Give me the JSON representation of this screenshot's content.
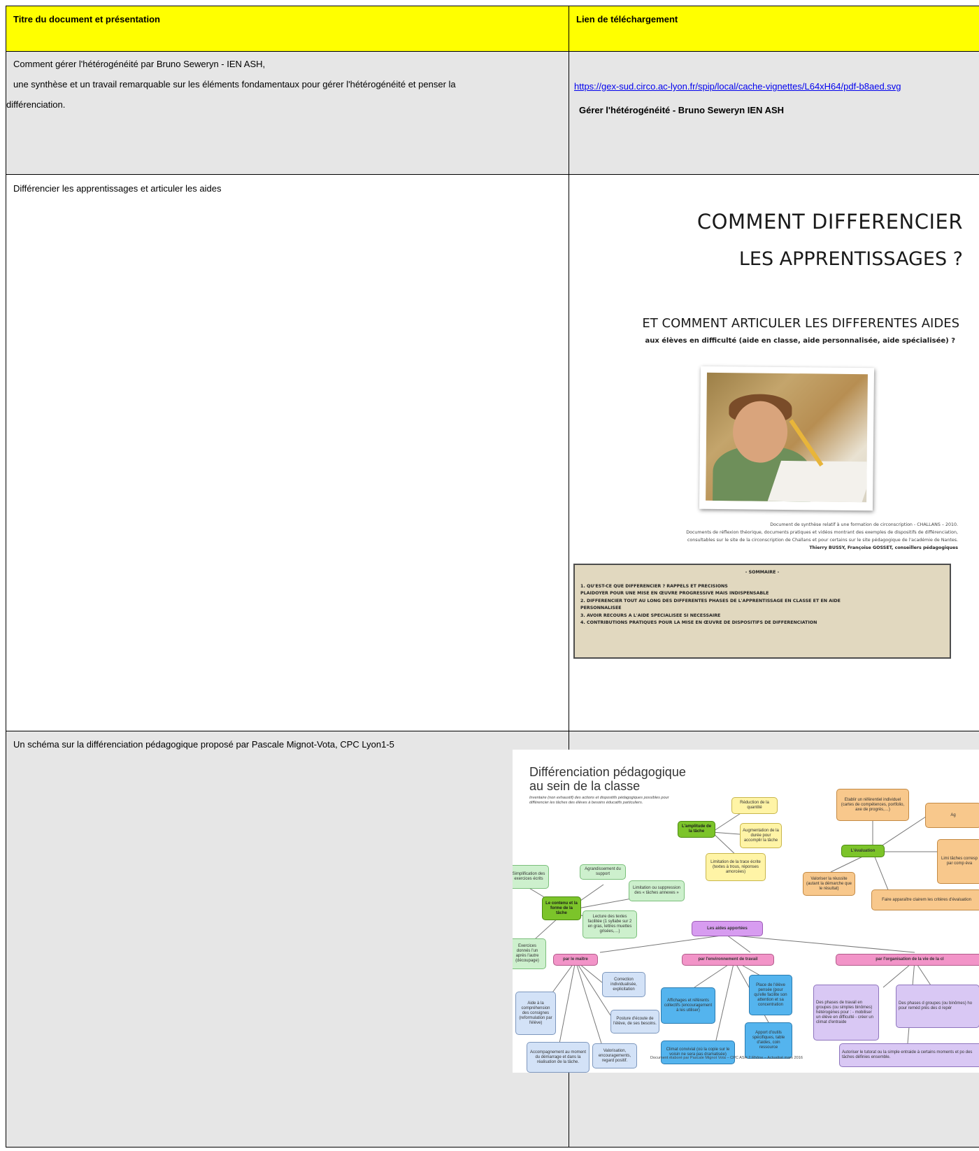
{
  "table": {
    "header": {
      "col1": "Titre du document et présentation",
      "col2": "Lien de téléchargement"
    },
    "row1": {
      "line1": "Comment gérer l'hétérogénéité par Bruno Seweryn - IEN ASH,",
      "line2": "une synthèse et un travail remarquable sur les éléments fondamentaux pour gérer l'hétérogénéité et penser la",
      "line3": "différenciation.",
      "link": "https://gex-sud.circo.ac-lyon.fr/spip/local/cache-vignettes/L64xH64/pdf-b8aed.svg",
      "link_title": "Gérer l'hétérogénéité - Bruno Seweryn IEN ASH"
    },
    "row2": {
      "text": "Différencier les apprentissages et articuler les aides"
    },
    "row3": {
      "text": "Un schéma sur la différenciation pédagogique proposé par Pascale Mignot-Vota, CPC Lyon1-5"
    }
  },
  "cover": {
    "title_line1": "COMMENT DIFFERENCIER",
    "title_line2": "LES APPRENTISSAGES ?",
    "subtitle": "ET COMMENT ARTICULER LES DIFFERENTES AIDES",
    "subtitle2": "aux élèves en difficulté (aide en classe, aide personnalisée, aide spécialisée) ?",
    "meta1": "Document de synthèse relatif à une formation de circonscription - CHALLANS – 2010.",
    "meta2": "Documents de réflexion théorique, documents pratiques et vidéos montrant des exemples de dispositifs de différenciation,",
    "meta3": "consultables sur le site de la circonscription de Challans et pour certains sur le site pédagogique de l'académie de Nantes.",
    "meta4": "Thierry BUSSY, Françoise GOSSET, conseillers pédagogiques",
    "sommaire_title": "- SOMMAIRE -",
    "sommaire_items": [
      "1.   QU'EST-CE QUE DIFFERENCIER ? RAPPELS ET PRECISIONS",
      "      PLAIDOYER POUR UNE MISE EN ŒUVRE PROGRESSIVE  MAIS INDISPENSABLE",
      "2.   DIFFERENCIER TOUT AU LONG DES DIFFERENTES PHASES DE L'APPRENTISSAGE EN CLASSE ET EN AIDE",
      "      PERSONNALISEE",
      "3.   AVOIR RECOURS A L'AIDE SPECIALISEE SI NECESSAIRE",
      "4.   CONTRIBUTIONS PRATIQUES POUR LA MISE EN ŒUVRE DE DISPOSITIFS DE DIFFERENCIATION"
    ]
  },
  "mindmap": {
    "title_line1": "Différenciation pédagogique",
    "title_line2": "au sein de la classe",
    "subtitle": "Inventaire (non exhaustif) des actions et dispositifs pédagogiques possibles pour différencier les tâches des élèves à besoins éducatifs particuliers.",
    "footer": "Document élaboré par Pascale Mignot Vota – CPC ASH 2 Rhône – Actualisé mars 2016",
    "nodes": {
      "simplification": "Simplification des exercices écrits",
      "agrandissement": "Agrandissement du support",
      "limitation_taches": "Limitation ou suppression des « tâches annexes »",
      "contenu": "Le contenu et la forme de la tâche",
      "lecture": "Lecture des textes facilitée (1 syllabe sur 2 en gras, lettres muettes grisées,…)",
      "exercices": "Exercices donnés l'un après l'autre (découpage)",
      "amplitude": "L'amplitude de la tâche",
      "reduction": "Réduction de la quantité",
      "augmentation": "Augmentation de la durée pour accomplir la tâche",
      "limitation_trace": "Limitation de la trace écrite (textes à trous, réponses amorcées)",
      "referentiel": "Etablir un référentiel individuel (cartes de compétences, portfolio, axe de progrès,…)",
      "ag": "Ag",
      "evaluation": "L'évaluation",
      "valoriser": "Valoriser la réussite (autant la démarche que le résultat)",
      "limi": "Limi tâches corresp par comp éva",
      "criteres": "Faire apparaître clairem les critères d'évaluation",
      "aides": "Les aides apportées",
      "maitre": "par le maître",
      "environnement": "par l'environnement de travail",
      "organisation": "par l'organisation de la vie de la cl",
      "correction": "Correction individualisée, explicitation",
      "aide_comp": "Aide à la compréhension des consignes (reformulation par l'élève)",
      "posture": "Posture d'écoute de l'élève, de ses besoins.",
      "accompagnement": "Accompagnement au moment du démarrage et dans la réalisation de la tâche.",
      "valorisation": "Valorisation, encouragements, regard positif.",
      "affichages": "Affichages et référents collectifs (encouragement à les utiliser)",
      "place": "Place de l'élève pensée (pour qu'elle facilite son attention et sa concentration",
      "climat": "Climat convivial (où la copie sur le voisin ne sera pas dramatisée)",
      "apport": "Apport d'outils spécifiques, table d'aides, coin ressource",
      "phases1": "Des phases de travail en groupes (ou simples binômes) hétérogènes pour : - mobiliser un élève en difficulté - créer un climat d'entraide",
      "phases2": "Des phases d groupes (ou binômes) ho pour reméd près des d repér",
      "tutorat": "Autoriser le tutorat ou la simple entraide à certains moments et po des tâches définies ensemble."
    }
  }
}
